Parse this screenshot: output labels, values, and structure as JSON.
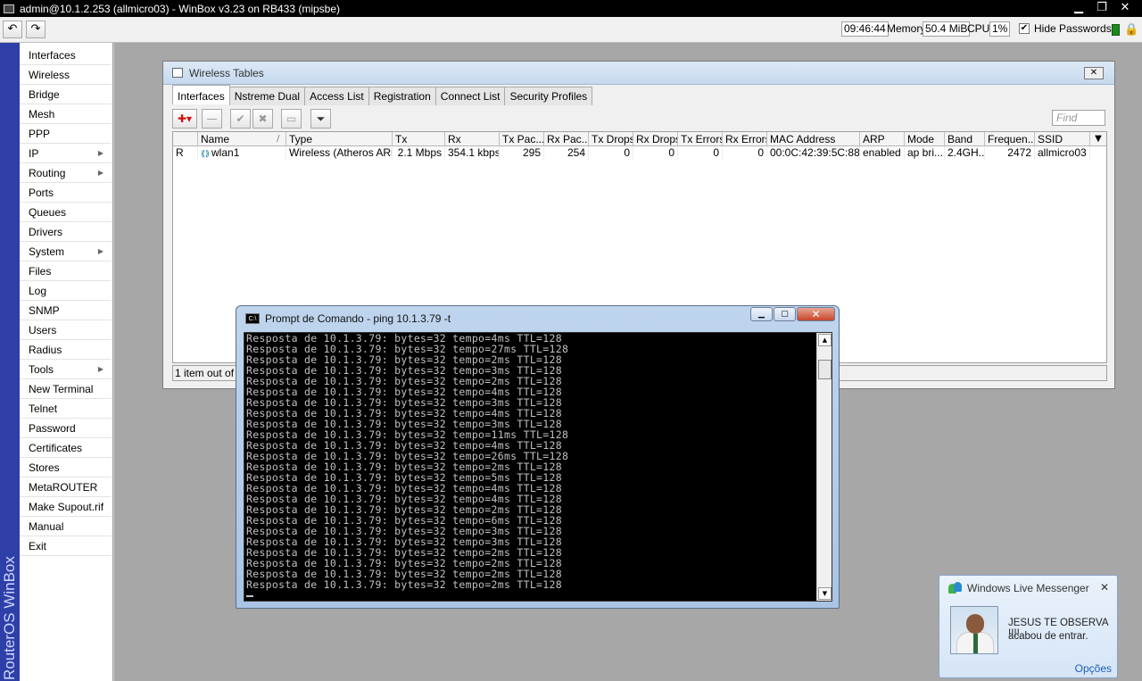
{
  "window": {
    "title": "admin@10.1.2.253 (allmicro03) - WinBox v3.23 on RB433 (mipsbe)",
    "min_icon": "minimize-icon",
    "max_icon": "maximize-icon",
    "close_icon": "close-icon"
  },
  "toolbar": {
    "undo_icon": "↶",
    "redo_icon": "↷",
    "time": "09:46:44",
    "memory_label": "Memory:",
    "memory_value": "50.4 MiB",
    "cpu_label": "CPU:",
    "cpu_value": "1%",
    "hide_passwords_label": "Hide Passwords",
    "hide_passwords_checked": "✔",
    "status_color": "#1c8a1c"
  },
  "brand": "RouterOS WinBox",
  "sidebar": {
    "items": [
      {
        "label": "Interfaces",
        "arrow": ""
      },
      {
        "label": "Wireless",
        "arrow": ""
      },
      {
        "label": "Bridge",
        "arrow": ""
      },
      {
        "label": "Mesh",
        "arrow": ""
      },
      {
        "label": "PPP",
        "arrow": ""
      },
      {
        "label": "IP",
        "arrow": "▶"
      },
      {
        "label": "Routing",
        "arrow": "▶"
      },
      {
        "label": "Ports",
        "arrow": ""
      },
      {
        "label": "Queues",
        "arrow": ""
      },
      {
        "label": "Drivers",
        "arrow": ""
      },
      {
        "label": "System",
        "arrow": "▶"
      },
      {
        "label": "Files",
        "arrow": ""
      },
      {
        "label": "Log",
        "arrow": ""
      },
      {
        "label": "SNMP",
        "arrow": ""
      },
      {
        "label": "Users",
        "arrow": ""
      },
      {
        "label": "Radius",
        "arrow": ""
      },
      {
        "label": "Tools",
        "arrow": "▶"
      },
      {
        "label": "New Terminal",
        "arrow": ""
      },
      {
        "label": "Telnet",
        "arrow": ""
      },
      {
        "label": "Password",
        "arrow": ""
      },
      {
        "label": "Certificates",
        "arrow": ""
      },
      {
        "label": "Stores",
        "arrow": ""
      },
      {
        "label": "MetaROUTER",
        "arrow": ""
      },
      {
        "label": "Make Supout.rif",
        "arrow": ""
      },
      {
        "label": "Manual",
        "arrow": ""
      },
      {
        "label": "Exit",
        "arrow": ""
      }
    ]
  },
  "wireless": {
    "title": "Wireless Tables",
    "close_label": "✕",
    "tabs": [
      {
        "label": "Interfaces"
      },
      {
        "label": "Nstreme Dual"
      },
      {
        "label": "Access List"
      },
      {
        "label": "Registration"
      },
      {
        "label": "Connect List"
      },
      {
        "label": "Security Profiles"
      }
    ],
    "tools": {
      "add": "✚▾",
      "remove": "—",
      "enable": "✔",
      "disable": "✖",
      "comment": "▭",
      "filter": "⏷"
    },
    "find_placeholder": "Find",
    "columns": [
      "",
      "Name",
      "Type",
      "Tx",
      "Rx",
      "Tx Pac...",
      "Rx Pac...",
      "Tx Drops",
      "Rx Drops",
      "Tx Errors",
      "Rx Errors",
      "MAC Address",
      "ARP",
      "Mode",
      "Band",
      "Frequen...",
      "SSID"
    ],
    "sort_indicator": "/",
    "col_menu": "▼",
    "rows": [
      {
        "flag": "R",
        "icon": "wireless-interface-icon",
        "cells": [
          "wlan1",
          "Wireless (Atheros AR5...",
          "2.1 Mbps",
          "354.1 kbps",
          "295",
          "254",
          "0",
          "0",
          "0",
          "0",
          "00:0C:42:39:5C:88",
          "enabled",
          "ap bri...",
          "2.4GH...",
          "2472",
          "allmicro03"
        ]
      }
    ],
    "status": "1 item out of 5"
  },
  "cmd": {
    "title": "Prompt de Comando - ping  10.1.3.79 -t",
    "icon_label": "C:\\",
    "lines": [
      "Resposta de 10.1.3.79: bytes=32 tempo=4ms TTL=128",
      "Resposta de 10.1.3.79: bytes=32 tempo=27ms TTL=128",
      "Resposta de 10.1.3.79: bytes=32 tempo=2ms TTL=128",
      "Resposta de 10.1.3.79: bytes=32 tempo=3ms TTL=128",
      "Resposta de 10.1.3.79: bytes=32 tempo=2ms TTL=128",
      "Resposta de 10.1.3.79: bytes=32 tempo=4ms TTL=128",
      "Resposta de 10.1.3.79: bytes=32 tempo=3ms TTL=128",
      "Resposta de 10.1.3.79: bytes=32 tempo=4ms TTL=128",
      "Resposta de 10.1.3.79: bytes=32 tempo=3ms TTL=128",
      "Resposta de 10.1.3.79: bytes=32 tempo=11ms TTL=128",
      "Resposta de 10.1.3.79: bytes=32 tempo=4ms TTL=128",
      "Resposta de 10.1.3.79: bytes=32 tempo=26ms TTL=128",
      "Resposta de 10.1.3.79: bytes=32 tempo=2ms TTL=128",
      "Resposta de 10.1.3.79: bytes=32 tempo=5ms TTL=128",
      "Resposta de 10.1.3.79: bytes=32 tempo=4ms TTL=128",
      "Resposta de 10.1.3.79: bytes=32 tempo=4ms TTL=128",
      "Resposta de 10.1.3.79: bytes=32 tempo=2ms TTL=128",
      "Resposta de 10.1.3.79: bytes=32 tempo=6ms TTL=128",
      "Resposta de 10.1.3.79: bytes=32 tempo=3ms TTL=128",
      "Resposta de 10.1.3.79: bytes=32 tempo=3ms TTL=128",
      "Resposta de 10.1.3.79: bytes=32 tempo=2ms TTL=128",
      "Resposta de 10.1.3.79: bytes=32 tempo=2ms TTL=128",
      "Resposta de 10.1.3.79: bytes=32 tempo=2ms TTL=128",
      "Resposta de 10.1.3.79: bytes=32 tempo=2ms TTL=128"
    ]
  },
  "messenger": {
    "title": "Windows Live Messenger",
    "close": "✕",
    "contact_name": "JESUS TE OBSERVA !!!!",
    "message": "acabou de entrar.",
    "options": "Opções"
  }
}
